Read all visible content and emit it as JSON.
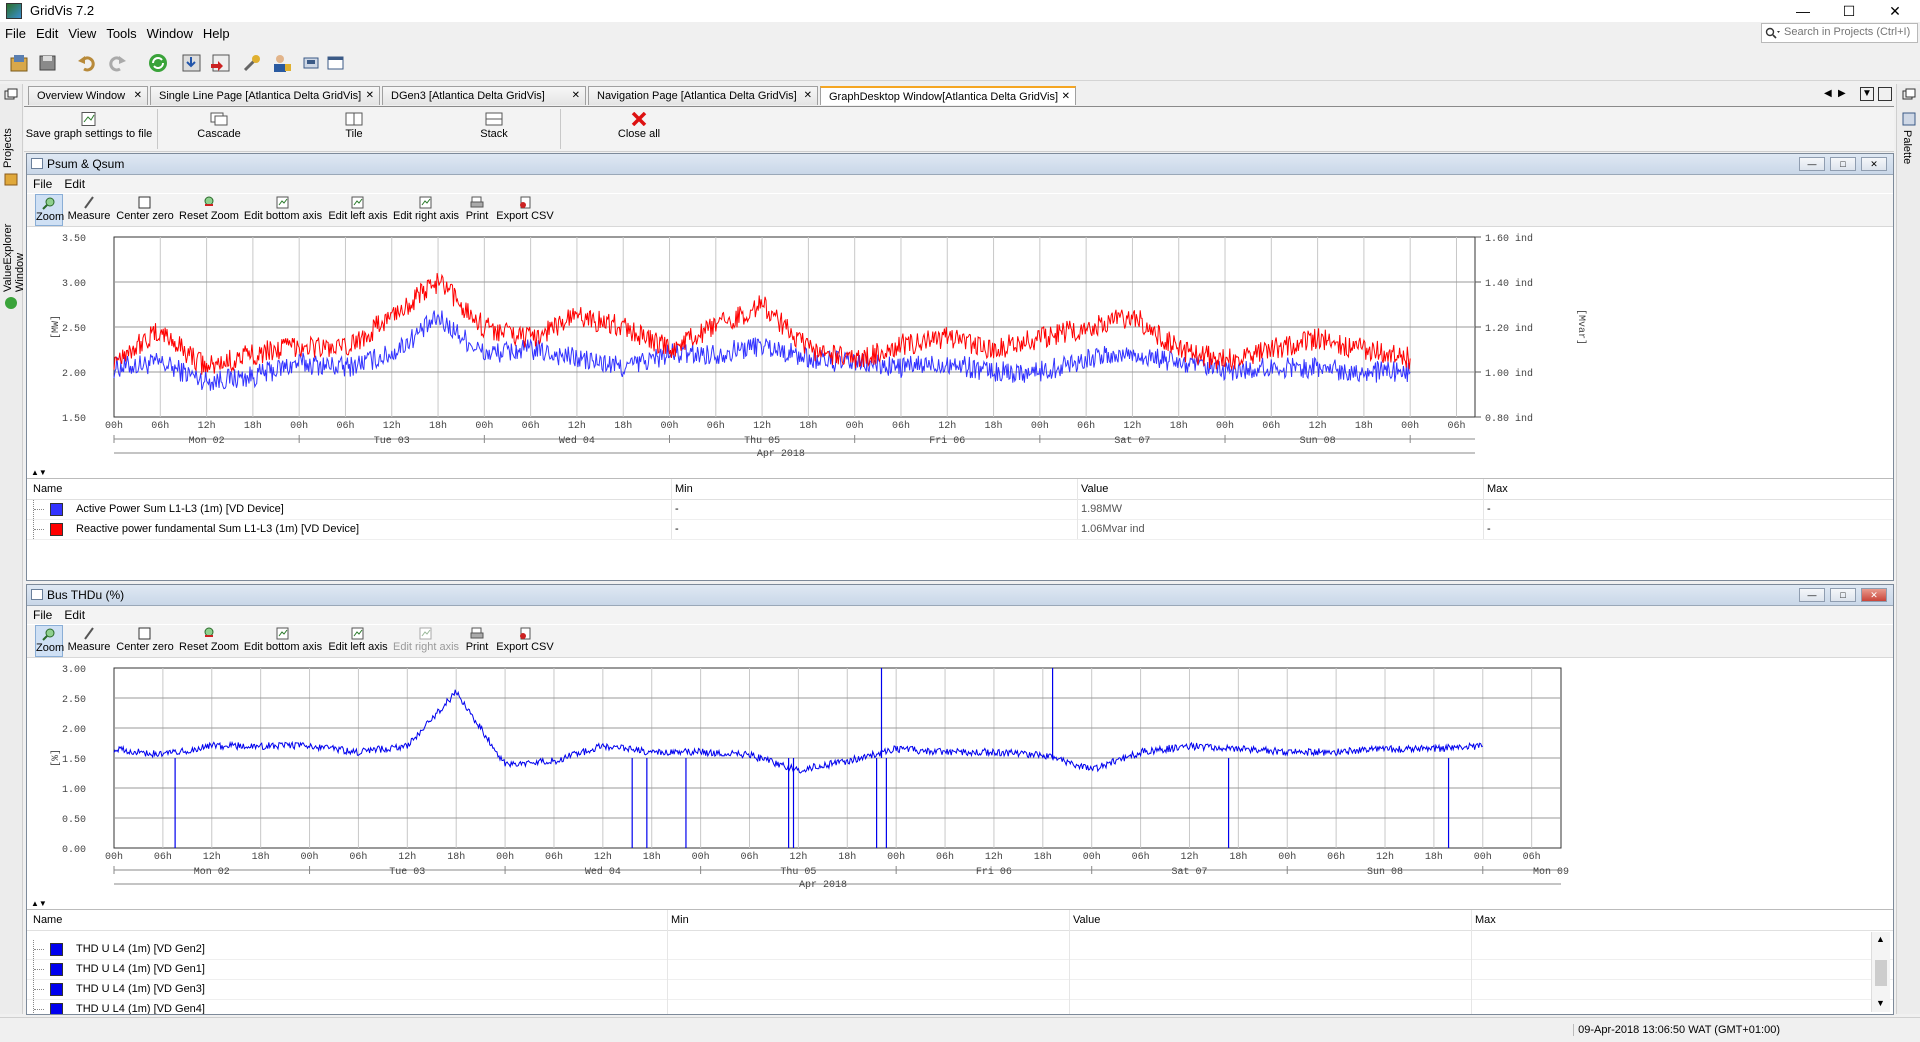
{
  "app": {
    "title": "GridVis 7.2"
  },
  "menu": [
    "File",
    "Edit",
    "View",
    "Tools",
    "Window",
    "Help"
  ],
  "search": {
    "placeholder": "Search in Projects (Ctrl+I)"
  },
  "side": {
    "left_tabs": [
      "Projects",
      "ValueExplorer Window"
    ],
    "right_tab": "Palette"
  },
  "doc_tabs": [
    {
      "label": "Overview Window"
    },
    {
      "label": "Single Line Page [Atlantica Delta GridVis]"
    },
    {
      "label": "DGen3 [Atlantica Delta GridVis]"
    },
    {
      "label": "Navigation Page [Atlantica Delta GridVis]"
    },
    {
      "label": "GraphDesktop Window[Atlantica Delta GridVis]",
      "active": true
    }
  ],
  "desktop_toolbar": {
    "save": "Save graph settings to file",
    "cascade": "Cascade",
    "tile": "Tile",
    "stack": "Stack",
    "close_all": "Close all"
  },
  "graph_menu": [
    "File",
    "Edit"
  ],
  "graph_toolbar": [
    "Zoom",
    "Measure",
    "Center zero",
    "Reset Zoom",
    "Edit bottom axis",
    "Edit left axis",
    "Edit right axis",
    "Print",
    "Export CSV"
  ],
  "time_axis": {
    "day_labels_1": [
      "Mon 02",
      "Tue 03",
      "Wed 04",
      "Thu 05",
      "Fri 06",
      "Sat 07",
      "Sun 08",
      "Mon 09"
    ],
    "month_label": "Apr 2018"
  },
  "graph1": {
    "title": "Psum & Qsum",
    "left_unit": "[MW]",
    "right_unit": "[Mvar]",
    "left_ticks": [
      "3.50",
      "3.00",
      "2.50",
      "2.00",
      "1.50"
    ],
    "right_ticks": [
      "1.60 ind",
      "1.40 ind",
      "1.20 ind",
      "1.00 ind",
      "0.80 ind"
    ],
    "x_ticks": [
      "00h",
      "06h",
      "12h",
      "18h",
      "00h",
      "06h",
      "12h",
      "18h",
      "00h",
      "06h",
      "12h",
      "18h",
      "00h",
      "06h",
      "12h",
      "18h",
      "00h",
      "06h",
      "12h",
      "18h",
      "00h",
      "06h",
      "12h",
      "18h",
      "00h",
      "06h",
      "12h",
      "18h",
      "00h",
      "06h"
    ],
    "headers": {
      "name": "Name",
      "min": "Min",
      "value": "Value",
      "max": "Max"
    },
    "rows": [
      {
        "name": "Active Power Sum L1-L3 (1m) [VD Device]",
        "min": "-",
        "value": "1.98MW",
        "max": "-",
        "color": "#3333ff"
      },
      {
        "name": "Reactive power fundamental Sum L1-L3 (1m) [VD Device]",
        "min": "-",
        "value": "1.06Mvar  ind",
        "max": "-",
        "color": "#ff0000"
      }
    ]
  },
  "graph2": {
    "title": "Bus THDu (%)",
    "left_unit": "[%]",
    "left_ticks": [
      "3.00",
      "2.50",
      "2.00",
      "1.50",
      "1.00",
      "0.50",
      "0.00"
    ],
    "x_ticks": [
      "00h",
      "06h",
      "12h",
      "18h",
      "00h",
      "06h",
      "12h",
      "18h",
      "00h",
      "06h",
      "12h",
      "18h",
      "00h",
      "06h",
      "12h",
      "18h",
      "00h",
      "06h",
      "12h",
      "18h",
      "00h",
      "06h",
      "12h",
      "18h",
      "00h",
      "06h",
      "12h",
      "18h",
      "00h",
      "06h"
    ],
    "headers": {
      "name": "Name",
      "min": "Min",
      "value": "Value",
      "max": "Max"
    },
    "rows": [
      {
        "name": "THD U L4 (1m) [VD Gen2]",
        "color": "#0000ee"
      },
      {
        "name": "THD U L4 (1m) [VD Gen1]",
        "color": "#0000ee"
      },
      {
        "name": "THD U L4 (1m) [VD Gen3]",
        "color": "#0000ee"
      },
      {
        "name": "THD U L4 (1m) [VD Gen4]",
        "color": "#0000ee"
      }
    ]
  },
  "chart_data": [
    {
      "type": "line",
      "title": "Psum & Qsum",
      "xlabel": "Apr 2018",
      "ylabel": "[MW]",
      "y2label": "[Mvar]",
      "x_range": [
        "2018-04-02 00h",
        "2018-04-09 06h"
      ],
      "ylim": [
        1.5,
        3.5
      ],
      "y2lim": [
        0.8,
        1.6
      ],
      "series": [
        {
          "name": "Active Power Sum L1-L3 (1m) [VD Device]",
          "color": "#3333ff",
          "axis": "left",
          "x": [
            "02 00h",
            "02 06h",
            "02 12h",
            "02 18h",
            "03 00h",
            "03 06h",
            "03 12h",
            "03 18h",
            "04 00h",
            "04 06h",
            "04 12h",
            "04 18h",
            "05 00h",
            "05 06h",
            "05 12h",
            "05 18h",
            "06 00h",
            "06 06h",
            "06 12h",
            "06 18h",
            "07 00h",
            "07 06h",
            "07 12h",
            "07 18h",
            "08 00h",
            "08 06h",
            "08 12h",
            "08 18h",
            "09 00h"
          ],
          "values": [
            2.05,
            2.1,
            1.9,
            1.95,
            2.1,
            2.05,
            2.2,
            2.6,
            2.2,
            2.25,
            2.15,
            2.05,
            2.2,
            2.2,
            2.3,
            2.15,
            2.1,
            2.05,
            2.1,
            2.0,
            2.0,
            2.15,
            2.2,
            2.1,
            2.0,
            2.05,
            2.05,
            2.0,
            2.0
          ]
        },
        {
          "name": "Reactive power fundamental Sum L1-L3 (1m) [VD Device]",
          "color": "#ff0000",
          "axis": "right",
          "x": [
            "02 00h",
            "02 06h",
            "02 12h",
            "02 18h",
            "03 00h",
            "03 06h",
            "03 12h",
            "03 18h",
            "04 00h",
            "04 06h",
            "04 12h",
            "04 18h",
            "05 00h",
            "05 06h",
            "05 12h",
            "05 18h",
            "06 00h",
            "06 06h",
            "06 12h",
            "06 18h",
            "07 00h",
            "07 06h",
            "07 12h",
            "07 18h",
            "08 00h",
            "08 06h",
            "08 12h",
            "08 18h",
            "09 00h"
          ],
          "values": [
            1.06,
            1.18,
            1.02,
            1.08,
            1.12,
            1.1,
            1.25,
            1.4,
            1.2,
            1.15,
            1.25,
            1.2,
            1.1,
            1.2,
            1.3,
            1.1,
            1.05,
            1.12,
            1.15,
            1.1,
            1.15,
            1.2,
            1.25,
            1.1,
            1.05,
            1.1,
            1.15,
            1.1,
            1.06
          ]
        }
      ]
    },
    {
      "type": "line",
      "title": "Bus THDu (%)",
      "xlabel": "Apr 2018",
      "ylabel": "[%]",
      "x_range": [
        "2018-04-02 00h",
        "2018-04-09 06h"
      ],
      "ylim": [
        0,
        3
      ],
      "series": [
        {
          "name": "THD U L4 (1m) [VD Gen2]",
          "color": "#0000ee",
          "x": [
            "02 00h",
            "02 06h",
            "02 12h",
            "02 18h",
            "03 00h",
            "03 06h",
            "03 12h",
            "03 18h",
            "04 00h",
            "04 06h",
            "04 12h",
            "04 18h",
            "05 00h",
            "05 06h",
            "05 12h",
            "05 18h",
            "06 00h",
            "06 06h",
            "06 12h",
            "06 18h",
            "07 00h",
            "07 06h",
            "07 12h",
            "07 18h",
            "08 00h",
            "08 06h",
            "08 12h",
            "08 18h",
            "09 00h"
          ],
          "values": [
            1.65,
            1.55,
            1.7,
            1.7,
            1.7,
            1.6,
            1.7,
            2.6,
            1.4,
            1.45,
            1.7,
            1.6,
            1.6,
            1.55,
            1.3,
            1.45,
            1.65,
            1.6,
            1.6,
            1.55,
            1.3,
            1.6,
            1.7,
            1.65,
            1.6,
            1.6,
            1.65,
            1.65,
            1.7
          ]
        }
      ]
    }
  ],
  "status": {
    "datetime": "09-Apr-2018 13:06:50 WAT (GMT+01:00)"
  }
}
